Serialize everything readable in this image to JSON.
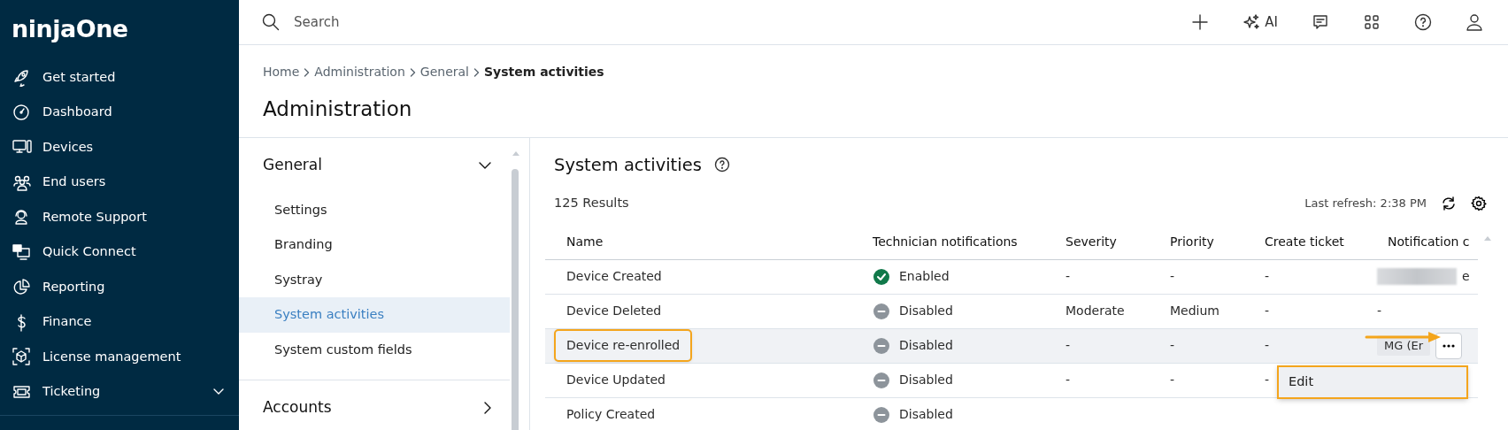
{
  "logo": {
    "text": "ninjaOne"
  },
  "sidebar": {
    "items": [
      {
        "label": "Get started",
        "expandable": false
      },
      {
        "label": "Dashboard",
        "expandable": false
      },
      {
        "label": "Devices",
        "expandable": false
      },
      {
        "label": "End users",
        "expandable": false
      },
      {
        "label": "Remote Support",
        "expandable": false
      },
      {
        "label": "Quick Connect",
        "expandable": false
      },
      {
        "label": "Reporting",
        "expandable": false
      },
      {
        "label": "Finance",
        "expandable": false
      },
      {
        "label": "License management",
        "expandable": false
      },
      {
        "label": "Ticketing",
        "expandable": true
      }
    ]
  },
  "topbar": {
    "search": {
      "placeholder": "Search"
    },
    "ai_label": "AI"
  },
  "breadcrumb": [
    {
      "label": "Home",
      "current": false
    },
    {
      "label": "Administration",
      "current": false
    },
    {
      "label": "General",
      "current": false
    },
    {
      "label": "System activities",
      "current": true
    }
  ],
  "page_title": "Administration",
  "subnav": {
    "sections": [
      {
        "title": "General",
        "expanded": true,
        "items": [
          {
            "label": "Settings",
            "selected": false
          },
          {
            "label": "Branding",
            "selected": false
          },
          {
            "label": "Systray",
            "selected": false
          },
          {
            "label": "System activities",
            "selected": true
          },
          {
            "label": "System custom fields",
            "selected": false
          }
        ]
      },
      {
        "title": "Accounts",
        "expanded": false
      }
    ]
  },
  "panel": {
    "title": "System activities",
    "results": "125 Results",
    "last_refresh": "Last refresh: 2:38 PM"
  },
  "table": {
    "columns": [
      "Name",
      "Technician notifications",
      "Severity",
      "Priority",
      "Create ticket",
      "Notification c"
    ],
    "rows": [
      {
        "name": "Device Created",
        "highlighted": false,
        "selected": false,
        "notifications": {
          "text": "Enabled",
          "enabled": true
        },
        "severity": "-",
        "priority": "-",
        "create_ticket": "-",
        "notification": {
          "kind": "blurred",
          "text": "e"
        }
      },
      {
        "name": "Device Deleted",
        "highlighted": false,
        "selected": false,
        "notifications": {
          "text": "Disabled",
          "enabled": false
        },
        "severity": "Moderate",
        "priority": "Medium",
        "create_ticket": "-",
        "notification": {
          "kind": "text",
          "text": "-"
        }
      },
      {
        "name": "Device re-enrolled",
        "highlighted": true,
        "selected": true,
        "notifications": {
          "text": "Disabled",
          "enabled": false
        },
        "severity": "-",
        "priority": "-",
        "create_ticket": "-",
        "notification": {
          "kind": "chip",
          "text": "MG (Er"
        }
      },
      {
        "name": "Device Updated",
        "highlighted": false,
        "selected": false,
        "notifications": {
          "text": "Disabled",
          "enabled": false
        },
        "severity": "-",
        "priority": "-",
        "create_ticket": "-"
      },
      {
        "name": "Policy Created",
        "highlighted": false,
        "selected": false,
        "notifications": {
          "text": "Disabled",
          "enabled": false
        }
      }
    ]
  },
  "context_menu": {
    "items": [
      {
        "label": "Edit",
        "highlighted": true
      }
    ]
  }
}
